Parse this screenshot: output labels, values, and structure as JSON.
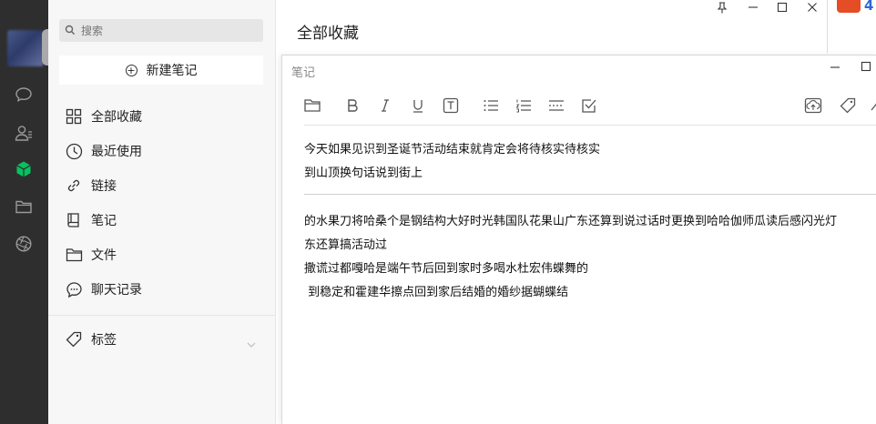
{
  "sidebar": {
    "search_placeholder": "搜索",
    "new_note_label": "新建笔记",
    "items": [
      {
        "label": "全部收藏",
        "icon": "grid-icon"
      },
      {
        "label": "最近使用",
        "icon": "clock-icon"
      },
      {
        "label": "链接",
        "icon": "link-icon"
      },
      {
        "label": "笔记",
        "icon": "book-icon"
      },
      {
        "label": "文件",
        "icon": "folder-icon"
      },
      {
        "label": "聊天记录",
        "icon": "chat-bubble-icon"
      }
    ],
    "tags_label": "标签"
  },
  "main": {
    "title": "全部收藏"
  },
  "note_window": {
    "title": "笔记",
    "lines": [
      "今天如果见识到圣诞节活动结束就肯定会将待核实待核实",
      "到山顶换句话说到街上",
      "的水果刀将哈桑个是钢结构大好时光韩国队花果山广东还算到说过话时更换到哈哈伽师瓜读后感闪光灯",
      "东还算搞活动过",
      "撒谎过都嘎哈是端午节后回到家时多喝水杜宏伟蝶舞的",
      " 到稳定和霍建华擦点回到家后结婚的婚纱据蝴蝶结"
    ]
  },
  "colors": {
    "rail": "#2e2e2e",
    "rail_active_icon": "#07c160",
    "sidebar_bg": "#f7f7f7"
  },
  "external_app": {
    "badge_text": "4"
  }
}
